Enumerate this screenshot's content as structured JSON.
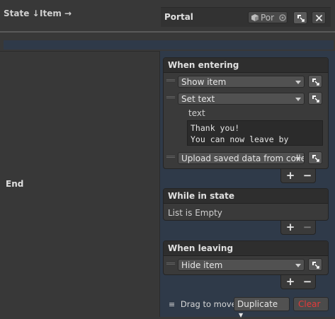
{
  "header": {
    "state_label": "State ↓",
    "item_label": "Item →",
    "portal_title": "Portal",
    "portal_field": "Por"
  },
  "row": {
    "state_name": "End"
  },
  "when_entering": {
    "title": "When entering",
    "actions": [
      {
        "label": "Show item"
      },
      {
        "label": "Set text",
        "param_label": "text",
        "text_value": "Thank you!\nYou can now leave by"
      },
      {
        "label": "Upload saved data from colle"
      }
    ],
    "add": "+",
    "remove": "−"
  },
  "while_in_state": {
    "title": "While in state",
    "empty_text": "List is Empty",
    "add": "+",
    "remove": "−"
  },
  "when_leaving": {
    "title": "When leaving",
    "actions": [
      {
        "label": "Hide item"
      }
    ],
    "add": "+",
    "remove": "−"
  },
  "footer": {
    "drag_label": "Drag to move",
    "duplicate_label": "Duplicate",
    "clear_label": "Clear"
  },
  "colors": {
    "accent_strip": "#2f3a49",
    "clear_red": "#e53a3a"
  }
}
